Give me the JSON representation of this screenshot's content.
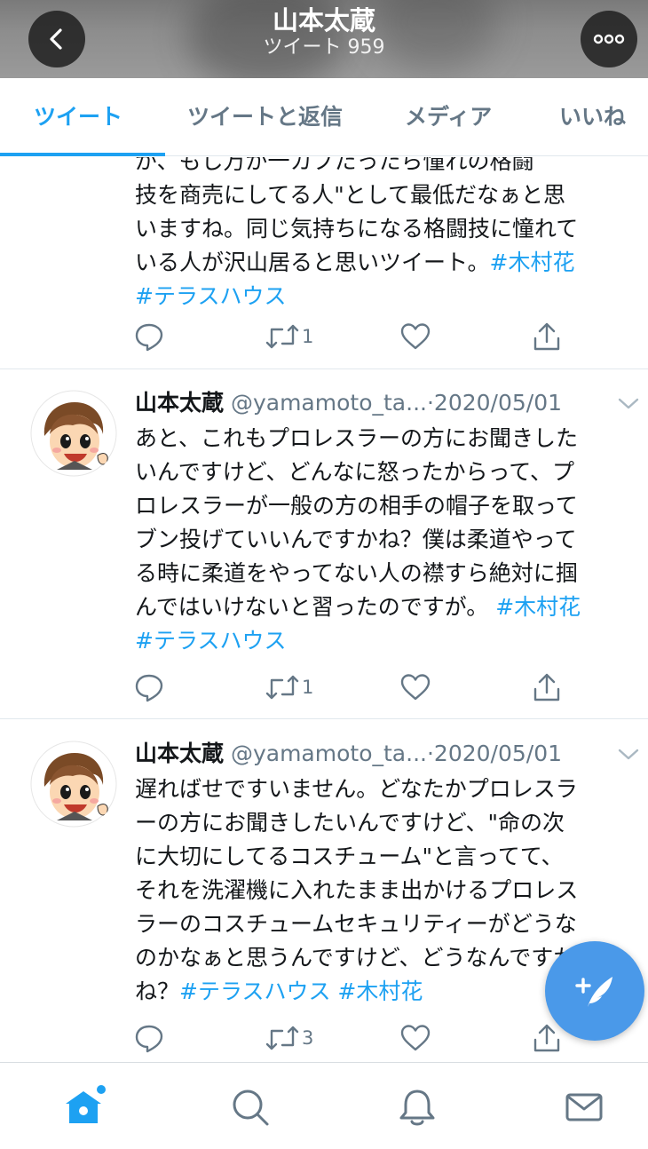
{
  "header": {
    "title": "山本太蔵",
    "subtitle": "ツイート 959"
  },
  "tabs": [
    {
      "label": "ツイート",
      "active": true
    },
    {
      "label": "ツイートと返信",
      "active": false
    },
    {
      "label": "メディア",
      "active": false
    },
    {
      "label": "いいね",
      "active": false
    }
  ],
  "tweets": [
    {
      "lines": [
        [
          {
            "t": "が、もし万が一カブ"
          },
          {
            "t": "たったら憧れの"
          },
          {
            "t": "格闘"
          }
        ],
        [
          {
            "t": "技を商売にしてる人\"として最低だなぁと思"
          }
        ],
        [
          {
            "t": "いますね。同じ気持ちになる格闘技に憧れて"
          }
        ],
        [
          {
            "t": "いる人が沢山居ると思いツイート。"
          },
          {
            "t": "#木村花",
            "tag": true
          }
        ],
        [
          {
            "t": "#テラスハウス",
            "tag": true
          }
        ]
      ],
      "retweets": "1",
      "likes": ""
    },
    {
      "name": "山本太蔵",
      "handle": "@yamamoto_ta...",
      "date": "2020/05/01",
      "lines": [
        [
          {
            "t": "あと、これもプロレスラーの方にお聞きした"
          }
        ],
        [
          {
            "t": "いんですけど、どんなに怒ったからって、プ"
          }
        ],
        [
          {
            "t": "ロレスラーが一般の方の相手の帽子を取って"
          }
        ],
        [
          {
            "t": "ブン投げていいんですかね？僕は柔道やって"
          }
        ],
        [
          {
            "t": "る時に柔道をやってない人の襟すら絶対に掴"
          }
        ],
        [
          {
            "t": "んではいけないと習ったのですが。 "
          },
          {
            "t": "#木村花",
            "tag": true
          }
        ],
        [
          {
            "t": "#テラスハウス",
            "tag": true
          }
        ]
      ],
      "retweets": "1",
      "likes": ""
    },
    {
      "name": "山本太蔵",
      "handle": "@yamamoto_ta...",
      "date": "2020/05/01",
      "lines": [
        [
          {
            "t": "遅ればせですいません。どなたかプロレスラ"
          }
        ],
        [
          {
            "t": "ーの方にお聞きしたいんですけど、\"命の次"
          }
        ],
        [
          {
            "t": "に大切にしてるコスチューム\"と言ってて、"
          }
        ],
        [
          {
            "t": "それを洗濯機に入れたまま出かけるプロレス"
          }
        ],
        [
          {
            "t": "ラーのコスチュームセキュリティーがどうな"
          }
        ],
        [
          {
            "t": "のかなぁと思うんですけど、どうなんですか"
          }
        ],
        [
          {
            "t": "ね？"
          },
          {
            "t": "#テラスハウス",
            "tag": true
          },
          {
            "t": " "
          },
          {
            "t": "#木村花",
            "tag": true
          }
        ]
      ],
      "retweets": "3",
      "likes": ""
    }
  ],
  "icons": {
    "back": "chevron-left-icon",
    "more": "more-icon",
    "reply": "reply-icon",
    "retweet": "retweet-icon",
    "like": "heart-icon",
    "share": "share-icon",
    "compose": "compose-tweet-icon",
    "home": "home-icon",
    "search": "search-icon",
    "notifications": "bell-icon",
    "messages": "mail-icon"
  },
  "colors": {
    "accent": "#1da1f2",
    "text": "#14171a",
    "secondary": "#657786"
  }
}
